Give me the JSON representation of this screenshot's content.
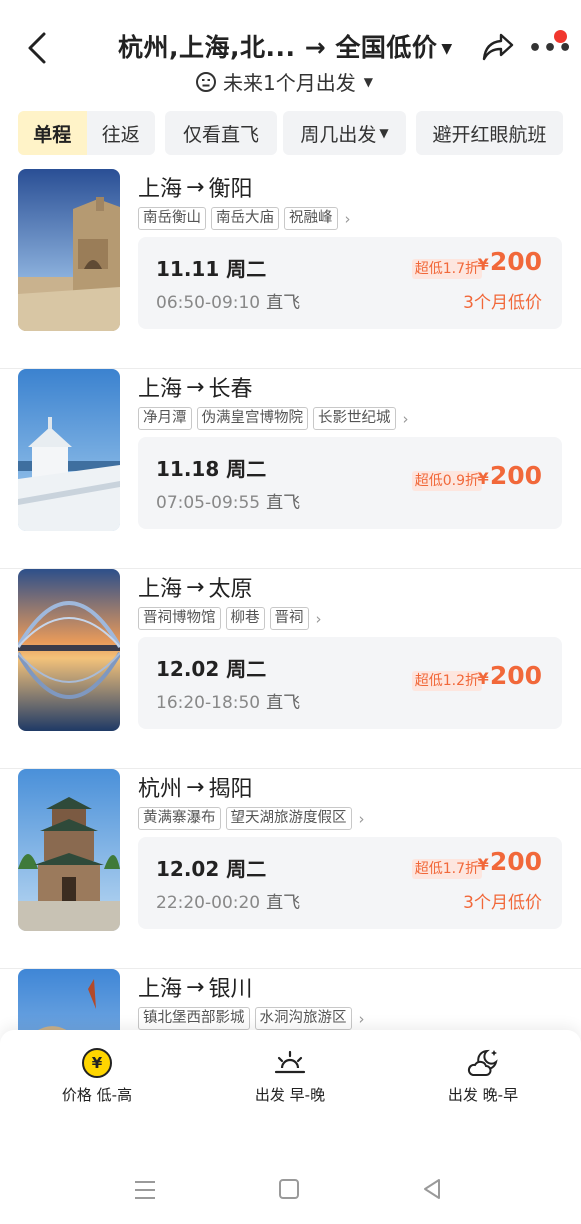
{
  "header": {
    "title": "杭州,上海,北... → 全国低价",
    "subtitle": "未来1个月出发"
  },
  "filters": {
    "one_way": "单程",
    "round_trip": "往返",
    "direct_only": "仅看直飞",
    "weekday": "周几出发",
    "avoid_redeye": "避开红眼航班"
  },
  "flights": [
    {
      "route_from": "上海",
      "route_to": "衡阳",
      "tags": [
        "南岳衡山",
        "南岳大庙",
        "祝融峰"
      ],
      "date": "11.11 周二",
      "time": "06:50-09:10",
      "type": "直飞",
      "discount": "超低1.7折",
      "price": "200",
      "low_label": "3个月低价"
    },
    {
      "route_from": "上海",
      "route_to": "长春",
      "tags": [
        "净月潭",
        "伪满皇宫博物院",
        "长影世纪城"
      ],
      "date": "11.18 周二",
      "time": "07:05-09:55",
      "type": "直飞",
      "discount": "超低0.9折",
      "price": "200",
      "low_label": ""
    },
    {
      "route_from": "上海",
      "route_to": "太原",
      "tags": [
        "晋祠博物馆",
        "柳巷",
        "晋祠"
      ],
      "date": "12.02 周二",
      "time": "16:20-18:50",
      "type": "直飞",
      "discount": "超低1.2折",
      "price": "200",
      "low_label": ""
    },
    {
      "route_from": "杭州",
      "route_to": "揭阳",
      "tags": [
        "黄满寨瀑布",
        "望天湖旅游度假区"
      ],
      "date": "12.02 周二",
      "time": "22:20-00:20",
      "type": "直飞",
      "discount": "超低1.7折",
      "price": "200",
      "low_label": "3个月低价"
    },
    {
      "route_from": "上海",
      "route_to": "银川",
      "tags": [
        "镇北堡西部影城",
        "水洞沟旅游区"
      ]
    }
  ],
  "currency": "¥",
  "arrow": "→",
  "sort": {
    "price": "价格 低-高",
    "early": "出发 早-晚",
    "late": "出发 晚-早"
  },
  "colors": {
    "accent": "#f1683a",
    "highlight": "#fff3c8",
    "badge": "#f1372e"
  }
}
